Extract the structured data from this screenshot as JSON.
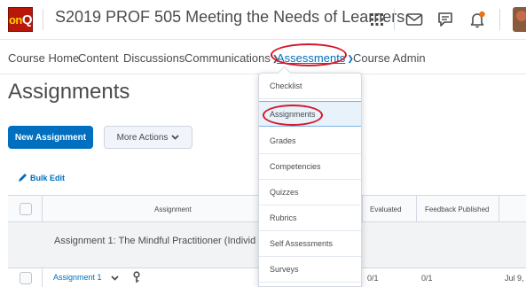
{
  "header": {
    "logo_on": "on",
    "logo_q": "Q",
    "course_title": "S2019 PROF 505 Meeting the Needs of Learners",
    "icons": [
      "waffle-icon",
      "mail-icon",
      "chat-icon",
      "bell-icon"
    ],
    "notification_color": "#e87511"
  },
  "nav": {
    "items": [
      {
        "label": "Course Home"
      },
      {
        "label": "Content"
      },
      {
        "label": "Discussions"
      },
      {
        "label": "Communications"
      },
      {
        "label": "Assessments",
        "active": true
      },
      {
        "label": "Course Admin"
      }
    ]
  },
  "page": {
    "title": "Assignments",
    "new_button": "New Assignment",
    "more_actions": "More Actions",
    "bulk_edit": "Bulk Edit"
  },
  "table": {
    "columns": [
      "Assignment",
      "Evaluated",
      "Feedback Published"
    ],
    "group_label": "Assignment 1: The Mindful Practitioner (Individ",
    "row": {
      "name": "Assignment 1",
      "evaluated": "0/1",
      "feedback": "0/1",
      "date": "Jul 9,"
    }
  },
  "dropdown": {
    "items": [
      {
        "label": "Checklist"
      },
      {
        "label": "Assignments",
        "selected": true
      },
      {
        "label": "Grades"
      },
      {
        "label": "Competencies"
      },
      {
        "label": "Quizzes"
      },
      {
        "label": "Rubrics"
      },
      {
        "label": "Self Assessments"
      },
      {
        "label": "Surveys"
      }
    ]
  },
  "colors": {
    "accent": "#006fbf",
    "annotation": "#d5172a",
    "logo_bg": "#b8170a"
  }
}
